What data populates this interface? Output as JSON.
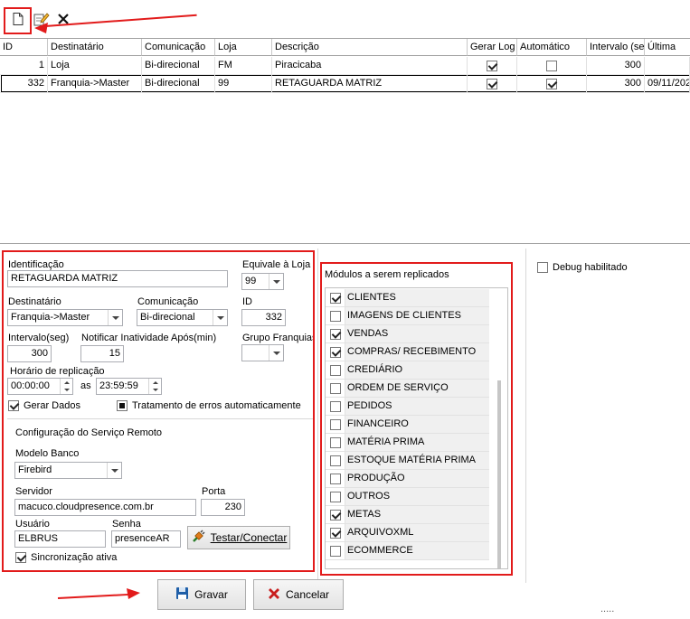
{
  "toolbar": {
    "new_icon": "new-document-icon",
    "edit_icon": "edit-icon",
    "delete_icon": "delete-icon"
  },
  "grid": {
    "columns": [
      "ID",
      "Destinatário",
      "Comunicação",
      "Loja",
      "Descrição",
      "Gerar Log",
      "Automático",
      "Intervalo (se",
      "Última"
    ],
    "rows": [
      {
        "id": "1",
        "destinatario": "Loja",
        "comunicacao": "Bi-direcional",
        "loja": "FM",
        "descricao": "Piracicaba",
        "gerar_log": true,
        "automatico": false,
        "intervalo": "300",
        "ultima": ""
      },
      {
        "id": "332",
        "destinatario": "Franquia->Master",
        "comunicacao": "Bi-direcional",
        "loja": "99",
        "descricao": "RETAGUARDA MATRIZ",
        "gerar_log": true,
        "automatico": true,
        "intervalo": "300",
        "ultima": "09/11/202"
      }
    ]
  },
  "form": {
    "identificacao_label": "Identificação",
    "identificacao_value": "RETAGUARDA MATRIZ",
    "equivale_label": "Equivale à Loja",
    "equivale_value": "99",
    "destinatario_label": "Destinatário",
    "destinatario_value": "Franquia->Master",
    "comunicacao_label": "Comunicação",
    "comunicacao_value": "Bi-direcional",
    "id_label": "ID",
    "id_value": "332",
    "intervalo_label": "Intervalo(seg)",
    "intervalo_value": "300",
    "notificar_label": "Notificar Inatividade Após(min)",
    "notificar_value": "15",
    "grupo_label": "Grupo Franquias",
    "grupo_value": "",
    "horario_label": "Horário de replicação",
    "horario_inicio": "00:00:00",
    "as_label": "as",
    "horario_fim": "23:59:59",
    "gerar_dados_label": "Gerar Dados",
    "gerar_dados_checked": true,
    "tratamento_label": "Tratamento de erros automaticamente",
    "tratamento_checked": true,
    "config_title": "Configuração do Serviço Remoto",
    "modelo_label": "Modelo Banco",
    "modelo_value": "Firebird",
    "servidor_label": "Servidor",
    "servidor_value": "macuco.cloudpresence.com.br",
    "porta_label": "Porta",
    "porta_value": "230",
    "usuario_label": "Usuário",
    "usuario_value": "ELBRUS",
    "senha_label": "Senha",
    "senha_value": "presenceAR",
    "testar_label": "Testar/Conectar",
    "sincronizacao_label": "Sincronização ativa",
    "sincronizacao_checked": true
  },
  "modules": {
    "title": "Módulos a serem replicados",
    "items": [
      {
        "label": "CLIENTES",
        "checked": true
      },
      {
        "label": "IMAGENS DE CLIENTES",
        "checked": false
      },
      {
        "label": "VENDAS",
        "checked": true
      },
      {
        "label": "COMPRAS/ RECEBIMENTO",
        "checked": true
      },
      {
        "label": "CREDIÁRIO",
        "checked": false
      },
      {
        "label": "ORDEM DE SERVIÇO",
        "checked": false
      },
      {
        "label": "PEDIDOS",
        "checked": false
      },
      {
        "label": "FINANCEIRO",
        "checked": false
      },
      {
        "label": "MATÉRIA PRIMA",
        "checked": false
      },
      {
        "label": "ESTOQUE MATÉRIA PRIMA",
        "checked": false
      },
      {
        "label": "PRODUÇÃO",
        "checked": false
      },
      {
        "label": "OUTROS",
        "checked": false
      },
      {
        "label": "METAS",
        "checked": true
      },
      {
        "label": "ARQUIVOXML",
        "checked": true
      },
      {
        "label": "ECOMMERCE",
        "checked": false
      }
    ]
  },
  "debug": {
    "label": "Debug habilitado",
    "checked": false
  },
  "footer": {
    "gravar_label": "Gravar",
    "cancelar_label": "Cancelar",
    "dots": "....."
  },
  "colors": {
    "annotation": "#e21b1b",
    "selected_row_border": "#000000"
  }
}
